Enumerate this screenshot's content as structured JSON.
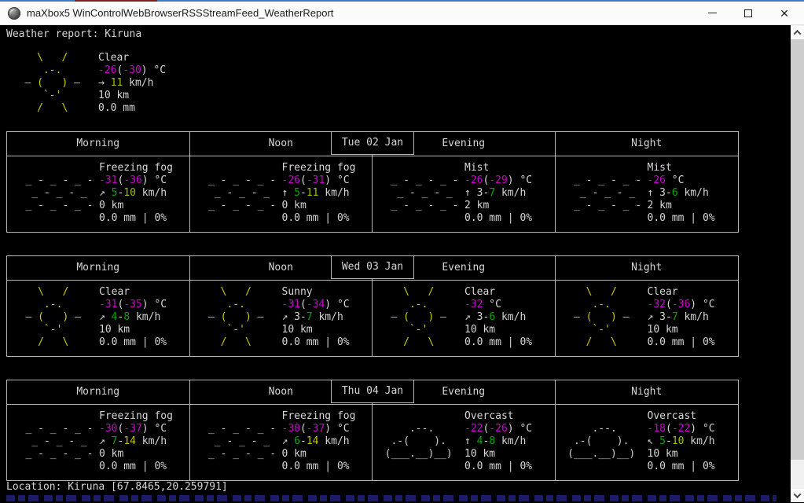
{
  "window": {
    "title": "maXbox5 WinControlWebBrowserRSSStreamFeed_WeatherReport",
    "icons": {
      "minimize": "–",
      "close": "✕"
    }
  },
  "colors": {
    "fg": "#d6d6d6",
    "m": "#cc00cc",
    "g": "#00a800",
    "yg": "#a4bd00",
    "y": "#c4c400",
    "sun": "#cdcd00",
    "art": "#cfcfcf",
    "border": "#b6b6b6",
    "clipped_text": "#20207a"
  },
  "report": {
    "header": "Weather report: Kiruna",
    "location_line": "Location: Kiruna [67.8465,20.259791]"
  },
  "art": {
    "sun": [
      "     \\   /",
      "      .-.",
      "   ― (   ) ―",
      "      `-'",
      "     /   \\"
    ],
    "fog": [
      "",
      "   _ - _ - _ -",
      "    _ - _ - _",
      "   _ - _ - _ -",
      ""
    ],
    "cloud": [
      "",
      "      .--.",
      "   .-(    ).",
      "  (___.__)__)",
      ""
    ]
  },
  "current": {
    "art": "sun",
    "cond": "Clear",
    "temp": [
      [
        "-26",
        "m"
      ],
      [
        "(",
        null
      ],
      [
        "-30",
        "m"
      ],
      [
        ")",
        null
      ],
      [
        " °C",
        null
      ]
    ],
    "wind": [
      [
        "→ ",
        null
      ],
      [
        "11",
        "yg"
      ],
      [
        " km/h",
        null
      ]
    ],
    "vis": "10 km",
    "precip": "0.0 mm"
  },
  "periods_header": [
    "Morning",
    "Noon",
    "Evening",
    "Night"
  ],
  "days": [
    {
      "date": "Tue 02 Jan",
      "periods": [
        {
          "name": "Morning",
          "art": "fog",
          "cond": "Freezing fog",
          "temp": [
            [
              "-31",
              "m"
            ],
            [
              "(",
              null
            ],
            [
              "-36",
              "m"
            ],
            [
              ")",
              null
            ],
            [
              " °C",
              null
            ]
          ],
          "wind": [
            [
              "↗ ",
              null
            ],
            [
              "5",
              "g"
            ],
            [
              "-",
              null
            ],
            [
              "10",
              "yg"
            ],
            [
              " km/h",
              null
            ]
          ],
          "vis": "0 km",
          "precip": "0.0 mm | 0%"
        },
        {
          "name": "Noon",
          "art": "fog",
          "cond": "Freezing fog",
          "temp": [
            [
              "-26",
              "m"
            ],
            [
              "(",
              null
            ],
            [
              "-31",
              "m"
            ],
            [
              ")",
              null
            ],
            [
              " °C",
              null
            ]
          ],
          "wind": [
            [
              "↑ ",
              null
            ],
            [
              "5",
              "g"
            ],
            [
              "-",
              null
            ],
            [
              "11",
              "yg"
            ],
            [
              " km/h",
              null
            ]
          ],
          "vis": "0 km",
          "precip": "0.0 mm | 0%"
        },
        {
          "name": "Evening",
          "art": "fog",
          "cond": "Mist",
          "temp": [
            [
              "-26",
              "m"
            ],
            [
              "(",
              null
            ],
            [
              "-29",
              "m"
            ],
            [
              ")",
              null
            ],
            [
              " °C",
              null
            ]
          ],
          "wind": [
            [
              "↑ ",
              null
            ],
            [
              "3",
              null
            ],
            [
              "-",
              null
            ],
            [
              "7",
              "g"
            ],
            [
              " km/h",
              null
            ]
          ],
          "vis": "2 km",
          "precip": "0.0 mm | 0%"
        },
        {
          "name": "Night",
          "art": "fog",
          "cond": "Mist",
          "temp": [
            [
              "-26",
              "m"
            ],
            [
              " °C",
              null
            ]
          ],
          "wind": [
            [
              "↑ ",
              null
            ],
            [
              "3",
              null
            ],
            [
              "-",
              null
            ],
            [
              "6",
              "g"
            ],
            [
              " km/h",
              null
            ]
          ],
          "vis": "2 km",
          "precip": "0.0 mm | 0%"
        }
      ]
    },
    {
      "date": "Wed 03 Jan",
      "periods": [
        {
          "name": "Morning",
          "art": "sun",
          "cond": "Clear",
          "temp": [
            [
              "-31",
              "m"
            ],
            [
              "(",
              null
            ],
            [
              "-35",
              "m"
            ],
            [
              ")",
              null
            ],
            [
              " °C",
              null
            ]
          ],
          "wind": [
            [
              "↗ ",
              null
            ],
            [
              "4",
              "g"
            ],
            [
              "-",
              null
            ],
            [
              "8",
              "g"
            ],
            [
              " km/h",
              null
            ]
          ],
          "vis": "10 km",
          "precip": "0.0 mm | 0%"
        },
        {
          "name": "Noon",
          "art": "sun",
          "cond": "Sunny",
          "temp": [
            [
              "-31",
              "m"
            ],
            [
              "(",
              null
            ],
            [
              "-34",
              "m"
            ],
            [
              ")",
              null
            ],
            [
              " °C",
              null
            ]
          ],
          "wind": [
            [
              "↗ ",
              null
            ],
            [
              "3",
              null
            ],
            [
              "-",
              null
            ],
            [
              "7",
              "g"
            ],
            [
              " km/h",
              null
            ]
          ],
          "vis": "10 km",
          "precip": "0.0 mm | 0%"
        },
        {
          "name": "Evening",
          "art": "sun",
          "cond": "Clear",
          "temp": [
            [
              "-32",
              "m"
            ],
            [
              " °C",
              null
            ]
          ],
          "wind": [
            [
              "↗ ",
              null
            ],
            [
              "3",
              null
            ],
            [
              "-",
              null
            ],
            [
              "6",
              "g"
            ],
            [
              " km/h",
              null
            ]
          ],
          "vis": "10 km",
          "precip": "0.0 mm | 0%"
        },
        {
          "name": "Night",
          "art": "sun",
          "cond": "Clear",
          "temp": [
            [
              "-32",
              "m"
            ],
            [
              "(",
              null
            ],
            [
              "-36",
              "m"
            ],
            [
              ")",
              null
            ],
            [
              " °C",
              null
            ]
          ],
          "wind": [
            [
              "↗ ",
              null
            ],
            [
              "3",
              null
            ],
            [
              "-",
              null
            ],
            [
              "7",
              "g"
            ],
            [
              " km/h",
              null
            ]
          ],
          "vis": "10 km",
          "precip": "0.0 mm | 0%"
        }
      ]
    },
    {
      "date": "Thu 04 Jan",
      "periods": [
        {
          "name": "Morning",
          "art": "fog",
          "cond": "Freezing fog",
          "temp": [
            [
              "-30",
              "m"
            ],
            [
              "(",
              null
            ],
            [
              "-37",
              "m"
            ],
            [
              ")",
              null
            ],
            [
              " °C",
              null
            ]
          ],
          "wind": [
            [
              "↗ ",
              null
            ],
            [
              "7",
              "g"
            ],
            [
              "-",
              null
            ],
            [
              "14",
              "y"
            ],
            [
              " km/h",
              null
            ]
          ],
          "vis": "0 km",
          "precip": "0.0 mm | 0%"
        },
        {
          "name": "Noon",
          "art": "fog",
          "cond": "Freezing fog",
          "temp": [
            [
              "-30",
              "m"
            ],
            [
              "(",
              null
            ],
            [
              "-37",
              "m"
            ],
            [
              ")",
              null
            ],
            [
              " °C",
              null
            ]
          ],
          "wind": [
            [
              "↗ ",
              null
            ],
            [
              "6",
              "g"
            ],
            [
              "-",
              null
            ],
            [
              "14",
              "y"
            ],
            [
              " km/h",
              null
            ]
          ],
          "vis": "0 km",
          "precip": "0.0 mm | 0%"
        },
        {
          "name": "Evening",
          "art": "cloud",
          "cond": "Overcast",
          "temp": [
            [
              "-22",
              "m"
            ],
            [
              "(",
              null
            ],
            [
              "-26",
              "m"
            ],
            [
              ")",
              null
            ],
            [
              " °C",
              null
            ]
          ],
          "wind": [
            [
              "↑ ",
              null
            ],
            [
              "4",
              "g"
            ],
            [
              "-",
              null
            ],
            [
              "8",
              "g"
            ],
            [
              " km/h",
              null
            ]
          ],
          "vis": "10 km",
          "precip": "0.0 mm | 0%"
        },
        {
          "name": "Night",
          "art": "cloud",
          "cond": "Overcast",
          "temp": [
            [
              "-18",
              "m"
            ],
            [
              "(",
              null
            ],
            [
              "-22",
              "m"
            ],
            [
              ")",
              null
            ],
            [
              " °C",
              null
            ]
          ],
          "wind": [
            [
              "↖ ",
              null
            ],
            [
              "5",
              "g"
            ],
            [
              "-",
              null
            ],
            [
              "10",
              "yg"
            ],
            [
              " km/h",
              null
            ]
          ],
          "vis": "10 km",
          "precip": "0.0 mm | 0%"
        }
      ]
    }
  ]
}
